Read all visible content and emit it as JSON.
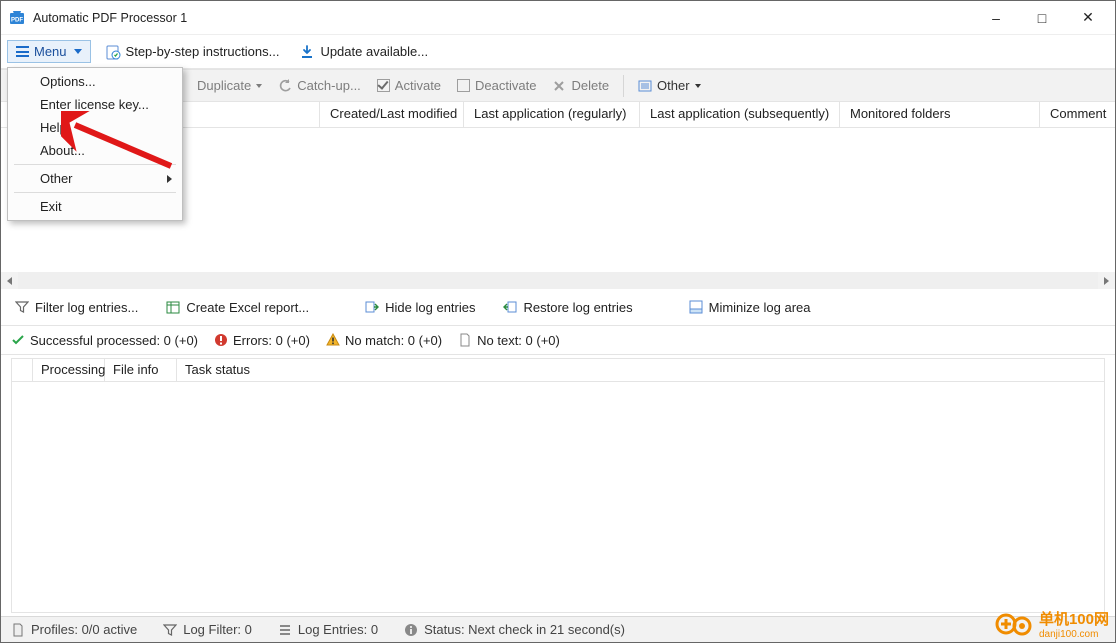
{
  "titlebar": {
    "title": "Automatic PDF Processor 1"
  },
  "menubar": {
    "menu_label": "Menu",
    "step_label": "Step-by-step instructions...",
    "update_label": "Update available..."
  },
  "dropdown": {
    "options": "Options...",
    "license": "Enter license key...",
    "help": "Help",
    "about": "About...",
    "other": "Other",
    "exit": "Exit"
  },
  "toolbar": {
    "duplicate": "Duplicate",
    "catchup": "Catch-up...",
    "activate": "Activate",
    "deactivate": "Deactivate",
    "delete": "Delete",
    "other": "Other"
  },
  "grid_columns": {
    "created": "Created/Last modified",
    "last_app_reg": "Last application (regularly)",
    "last_app_sub": "Last application (subsequently)",
    "monitored": "Monitored folders",
    "comment": "Comment"
  },
  "log_toolbar": {
    "filter": "Filter log entries...",
    "excel": "Create Excel report...",
    "hide": "Hide log entries",
    "restore": "Restore log entries",
    "minimize": "Miminize log area"
  },
  "stats": {
    "success": "Successful processed: 0  (+0)",
    "errors": "Errors: 0  (+0)",
    "nomatch": "No match: 0  (+0)",
    "notext": "No text: 0  (+0)"
  },
  "log_columns": {
    "processing": "Processing",
    "fileinfo": "File info",
    "taskstatus": "Task status"
  },
  "statusbar": {
    "profiles": "Profiles: 0/0 active",
    "logfilter": "Log Filter: 0",
    "logentries": "Log Entries: 0",
    "status": "Status: Next check in 21 second(s)"
  },
  "watermark": {
    "line1": "单机100网",
    "line2": "danji100.com"
  }
}
